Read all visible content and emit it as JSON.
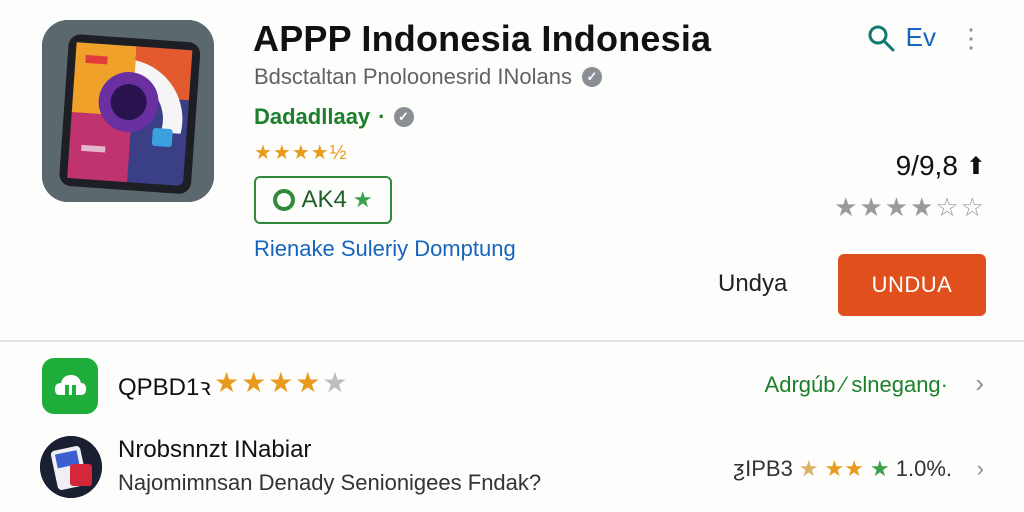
{
  "app": {
    "title": "APPP Indonesia Indonesia",
    "developer": "Bdsctaltan Pnoloonesrid INolans",
    "category": "Dadadllaay",
    "category_suffix": "·",
    "header_stars": "★★★★½",
    "badge": "AK4",
    "link": "Rienake Suleriy Domptung"
  },
  "actions": {
    "search_icon": "search-icon",
    "lang": "Ev",
    "more_icon": "⋮"
  },
  "rating": {
    "value": "9/9,8",
    "arrow": "🡅",
    "stars": "★★★★☆☆",
    "star_level_out_of_5": 3.5
  },
  "download": {
    "label": "Undya",
    "button": "UNDUA"
  },
  "list": [
    {
      "name": "QPBD1ꝛ",
      "stars_on": "★★★★",
      "stars_off": "★",
      "category": "Adrgúb ⁄ slnegang·",
      "chevron": "›"
    },
    {
      "name": "Nrobsnnzt INabiar",
      "description": "Najomimnsan Denady Senionigees Fndak?",
      "rating_prefix": "ƺIPB3",
      "star_half": "★",
      "stars_orange": "★★",
      "star_green": "★",
      "percent": "1.0%.",
      "chevron": "›"
    }
  ],
  "colors": {
    "accent_orange": "#e0501d",
    "green": "#1b7f2b",
    "link_blue": "#1565c0",
    "star_orange": "#e89a1c"
  }
}
